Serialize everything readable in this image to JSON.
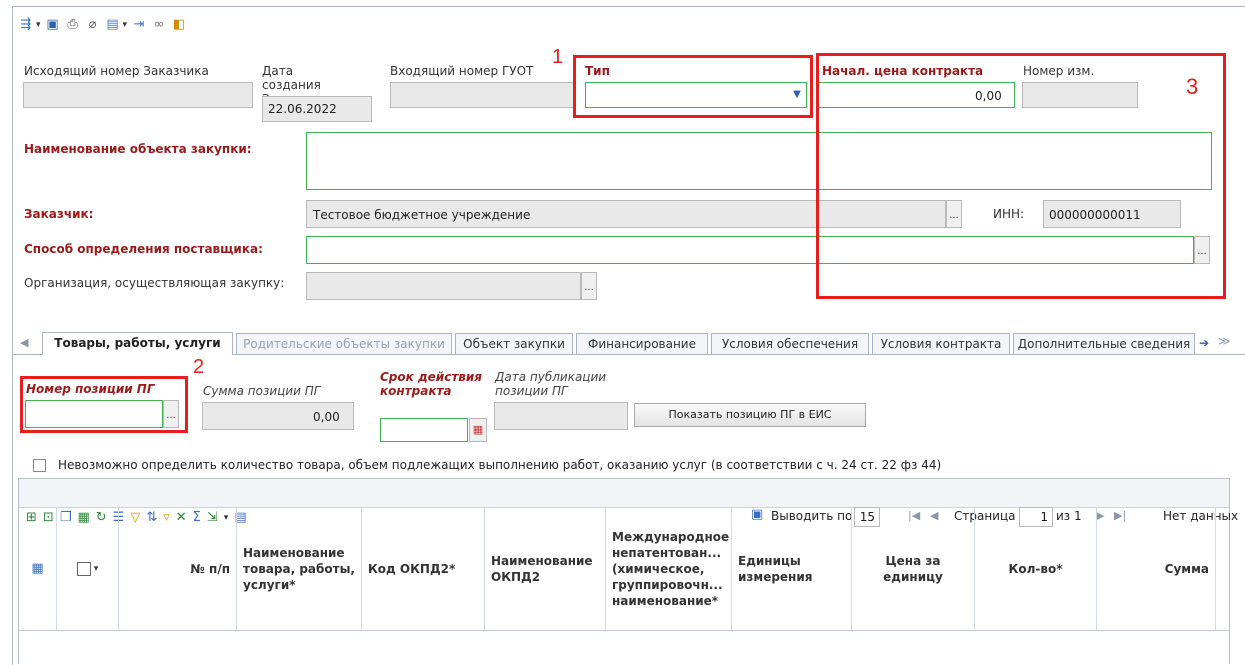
{
  "header": {
    "outgoing_number_label": "Исходящий номер Заказчика",
    "created_date_label": "Дата создания Заказчиком",
    "created_date_value": "22.06.2022",
    "incoming_number_label": "Входящий номер ГУОТ",
    "type_label": "Тип",
    "initial_price_label": "Начал. цена контракта",
    "initial_price_value": "0,00",
    "change_number_label": "Номер изм."
  },
  "form": {
    "purchase_object_label": "Наименование объекта закупки:",
    "customer_label": "Заказчик:",
    "customer_value": "Тестовое бюджетное учреждение",
    "inn_label": "ИНН:",
    "inn_value": "000000000011",
    "supplier_method_label": "Способ определения поставщика:",
    "organization_label": "Организация, осуществляющая закупку:",
    "ellipsis": "..."
  },
  "annotations": {
    "n1": "1",
    "n2": "2",
    "n3": "3"
  },
  "tabs": [
    {
      "label": "Товары, работы, услуги"
    },
    {
      "label": "Родительские объекты закупки"
    },
    {
      "label": "Объект закупки"
    },
    {
      "label": "Финансирование"
    },
    {
      "label": "Условия обеспечения"
    },
    {
      "label": "Условия контракта"
    },
    {
      "label": "Дополнительные сведения"
    }
  ],
  "goods": {
    "plan_position_label": "Номер позиции ПГ",
    "plan_sum_label": "Сумма позиции ПГ",
    "plan_sum_value": "0,00",
    "contract_term_label": "Срок действия контракта",
    "publish_date_label": "Дата публикации позиции ПГ",
    "show_button": "Показать позицию ПГ в ЕИС",
    "checkbox_label": "Невозможно определить количество товара, объем подлежащих выполнению работ, оказанию услуг (в соответствии с ч. 24 ст. 22 фз 44)"
  },
  "grid": {
    "show_by_label": "Выводить по",
    "show_by_value": "15",
    "page_label": "Страница",
    "page_value": "1",
    "page_of": "из 1",
    "no_data": "Нет данных",
    "columns": [
      "№ п/п",
      "Наименование товара, работы, услуги*",
      "Код ОКПД2*",
      "Наименование ОКПД2",
      "Международное непатентован... (химическое, группировочн... наименование*",
      "Единицы измерения",
      "Цена за единицу",
      "Кол-во*",
      "Сумма"
    ]
  },
  "colors": {
    "accent_red": "#e81e1e",
    "required_label": "#9b1b1b",
    "valid_border": "#3fb34f"
  }
}
